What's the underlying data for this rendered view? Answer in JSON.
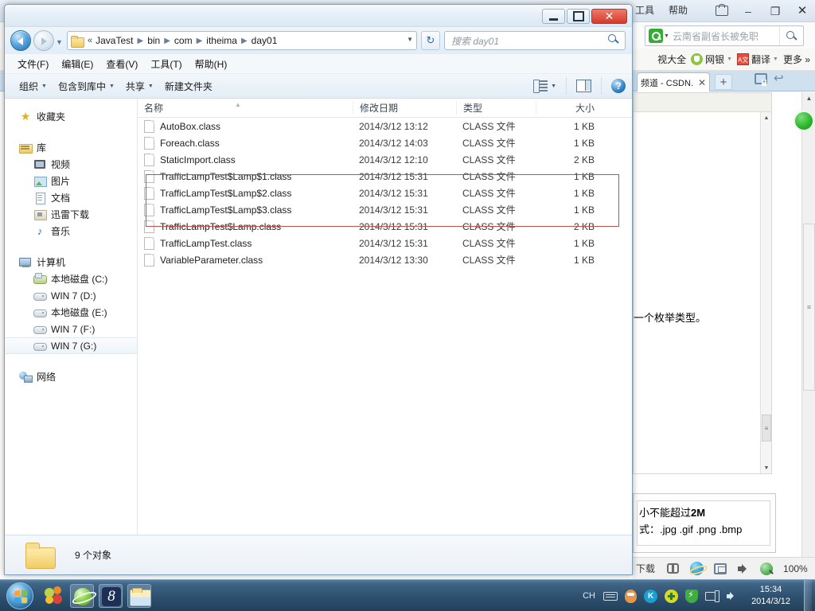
{
  "browser": {
    "menu": [
      "工具",
      "帮助"
    ],
    "window_controls": {
      "shirt": "shirt-icon",
      "minimize": "–",
      "maximize": "❐",
      "close": "✕"
    },
    "search": {
      "value": "云南省副省长被免职",
      "engine_icon": "search-engine-icon",
      "button_icon": "search-icon"
    },
    "bookmarks": [
      {
        "label": "视大全",
        "has_caret": false,
        "icon": ""
      },
      {
        "label": "网银",
        "has_caret": true,
        "icon": "shield"
      },
      {
        "label": "翻译",
        "has_caret": true,
        "icon": "translate"
      },
      {
        "label": "更多 »",
        "has_caret": false,
        "icon": ""
      }
    ],
    "tab": {
      "title": "频道 - CSDN.",
      "close": "✕"
    },
    "new_tab": "+",
    "page_text": "一个枚举类型。",
    "tip_box": {
      "line1_prefix": "小不能超过",
      "line1_bold": "2M",
      "line2": "式：.jpg .gif .png .bmp"
    },
    "statusbar": {
      "download_label": "下载",
      "zoom": "100%",
      "icons": [
        "flag-icon",
        "ie-icon",
        "screen-icon",
        "speaker-icon",
        "zoom-icon"
      ]
    }
  },
  "explorer": {
    "window_controls": {
      "minimize": "minimize",
      "maximize": "maximize",
      "close": "✕"
    },
    "address": {
      "chevron": "«",
      "crumbs": [
        "JavaTest",
        "bin",
        "com",
        "itheima",
        "day01"
      ],
      "separator": "▶",
      "dropdown": "▼"
    },
    "refresh": "↻",
    "search": {
      "placeholder": "搜索 day01"
    },
    "menubar": [
      "文件(F)",
      "编辑(E)",
      "查看(V)",
      "工具(T)",
      "帮助(H)"
    ],
    "toolbar": {
      "organize": "组织",
      "include_in_library": "包含到库中",
      "share": "共享",
      "new_folder": "新建文件夹",
      "caret": "▼"
    },
    "nav": {
      "groups": [
        {
          "items": [
            {
              "label": "收藏夹",
              "icon": "star-icon",
              "level": 0,
              "selected": false
            }
          ]
        },
        {
          "items": [
            {
              "label": "库",
              "icon": "library-icon",
              "level": 0,
              "selected": false
            },
            {
              "label": "视频",
              "icon": "video-icon",
              "level": 1,
              "selected": false
            },
            {
              "label": "图片",
              "icon": "pictures-icon",
              "level": 1,
              "selected": false
            },
            {
              "label": "文档",
              "icon": "documents-icon",
              "level": 1,
              "selected": false
            },
            {
              "label": "迅雷下载",
              "icon": "downloads-icon",
              "level": 1,
              "selected": false
            },
            {
              "label": "音乐",
              "icon": "music-icon",
              "level": 1,
              "selected": false
            }
          ]
        },
        {
          "items": [
            {
              "label": "计算机",
              "icon": "computer-icon",
              "level": 0,
              "selected": false
            },
            {
              "label": "本地磁盘 (C:)",
              "icon": "system-disk-icon",
              "level": 1,
              "selected": false
            },
            {
              "label": "WIN 7 (D:)",
              "icon": "disk-icon",
              "level": 1,
              "selected": false
            },
            {
              "label": "本地磁盘 (E:)",
              "icon": "disk-icon",
              "level": 1,
              "selected": false
            },
            {
              "label": "WIN 7 (F:)",
              "icon": "disk-icon",
              "level": 1,
              "selected": false
            },
            {
              "label": "WIN 7 (G:)",
              "icon": "disk-icon",
              "level": 1,
              "selected": true
            }
          ]
        },
        {
          "items": [
            {
              "label": "网络",
              "icon": "network-icon",
              "level": 0,
              "selected": false
            }
          ]
        }
      ]
    },
    "columns": [
      "名称",
      "修改日期",
      "类型",
      "大小"
    ],
    "files": [
      {
        "name": "AutoBox.class",
        "date": "2014/3/12 13:12",
        "type": "CLASS 文件",
        "size": "1 KB",
        "highlighted": false
      },
      {
        "name": "Foreach.class",
        "date": "2014/3/12 14:03",
        "type": "CLASS 文件",
        "size": "1 KB",
        "highlighted": false
      },
      {
        "name": "StaticImport.class",
        "date": "2014/3/12 12:10",
        "type": "CLASS 文件",
        "size": "2 KB",
        "highlighted": false
      },
      {
        "name": "TrafficLampTest$Lamp$1.class",
        "date": "2014/3/12 15:31",
        "type": "CLASS 文件",
        "size": "1 KB",
        "highlighted": true
      },
      {
        "name": "TrafficLampTest$Lamp$2.class",
        "date": "2014/3/12 15:31",
        "type": "CLASS 文件",
        "size": "1 KB",
        "highlighted": true
      },
      {
        "name": "TrafficLampTest$Lamp$3.class",
        "date": "2014/3/12 15:31",
        "type": "CLASS 文件",
        "size": "1 KB",
        "highlighted": true
      },
      {
        "name": "TrafficLampTest$Lamp.class",
        "date": "2014/3/12 15:31",
        "type": "CLASS 文件",
        "size": "2 KB",
        "highlighted": false
      },
      {
        "name": "TrafficLampTest.class",
        "date": "2014/3/12 15:31",
        "type": "CLASS 文件",
        "size": "1 KB",
        "highlighted": false
      },
      {
        "name": "VariableParameter.class",
        "date": "2014/3/12 13:30",
        "type": "CLASS 文件",
        "size": "1 KB",
        "highlighted": false
      }
    ],
    "status": "9 个对象",
    "highlight_color": "#c0504d"
  },
  "taskbar": {
    "start": "start-orb",
    "quick_launch": [
      "media-player-icon",
      "green-browser-icon",
      "number-eight-icon",
      "explorer-icon"
    ],
    "tray": {
      "ime": "CH",
      "icons": [
        "keyboard-icon",
        "qq-icon",
        "kingsoft-icon",
        "update-icon",
        "security-shield-icon",
        "network-icon",
        "volume-icon"
      ]
    },
    "clock": {
      "time": "15:34",
      "date": "2014/3/12"
    }
  }
}
